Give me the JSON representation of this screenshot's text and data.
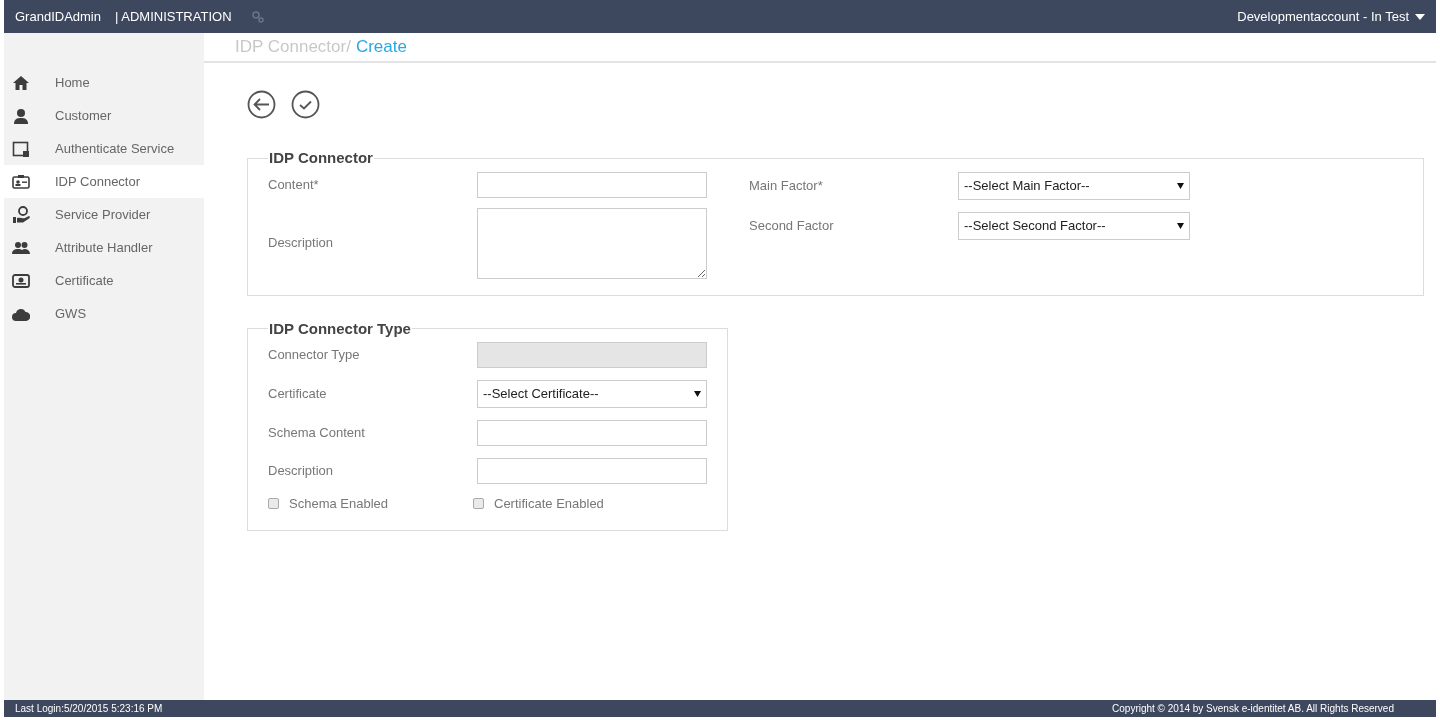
{
  "header": {
    "brand": "GrandIDAdmin",
    "section": "| ADMINISTRATION",
    "account": "Developmentaccount - In Test"
  },
  "sidebar": {
    "items": [
      {
        "label": "Home",
        "kind": "home",
        "selected": false
      },
      {
        "label": "Customer",
        "kind": "user",
        "selected": false
      },
      {
        "label": "Authenticate Service",
        "kind": "lock",
        "selected": false
      },
      {
        "label": "IDP Connector",
        "kind": "card",
        "selected": true
      },
      {
        "label": "Service Provider",
        "kind": "hand",
        "selected": false
      },
      {
        "label": "Attribute Handler",
        "kind": "users",
        "selected": false
      },
      {
        "label": "Certificate",
        "kind": "cert",
        "selected": false
      },
      {
        "label": "GWS",
        "kind": "cloud",
        "selected": false
      }
    ]
  },
  "breadcrumb": {
    "parent": "IDP Connector/",
    "current": "Create"
  },
  "connector": {
    "legend": "IDP Connector",
    "left": [
      {
        "label": "Content*",
        "kind": "text"
      },
      {
        "label": "Description",
        "kind": "textarea"
      }
    ],
    "right": [
      {
        "label": "Main Factor*",
        "kind": "select",
        "value": "--Select Main Factor--"
      },
      {
        "label": "Second Factor",
        "kind": "select",
        "value": "--Select Second Factor--"
      }
    ]
  },
  "connector_type": {
    "legend": "IDP Connector Type",
    "fields": [
      {
        "label": "Connector Type",
        "kind": "text",
        "disabled": true
      },
      {
        "label": "Certificate",
        "kind": "select",
        "value": "--Select Certificate--",
        "disabled": false
      },
      {
        "label": "Schema Content",
        "kind": "text",
        "disabled": false
      },
      {
        "label": "Description",
        "kind": "text",
        "disabled": false
      }
    ],
    "checkboxes": [
      {
        "label": "Schema Enabled",
        "checked": false
      },
      {
        "label": "Certificate Enabled",
        "checked": false
      }
    ]
  },
  "status_bar": {
    "last_login": "Last Login:5/20/2015 5:23:16 PM",
    "copyright": "Copyright © 2014 by Svensk e-identitet AB. All Rights Reserved"
  }
}
